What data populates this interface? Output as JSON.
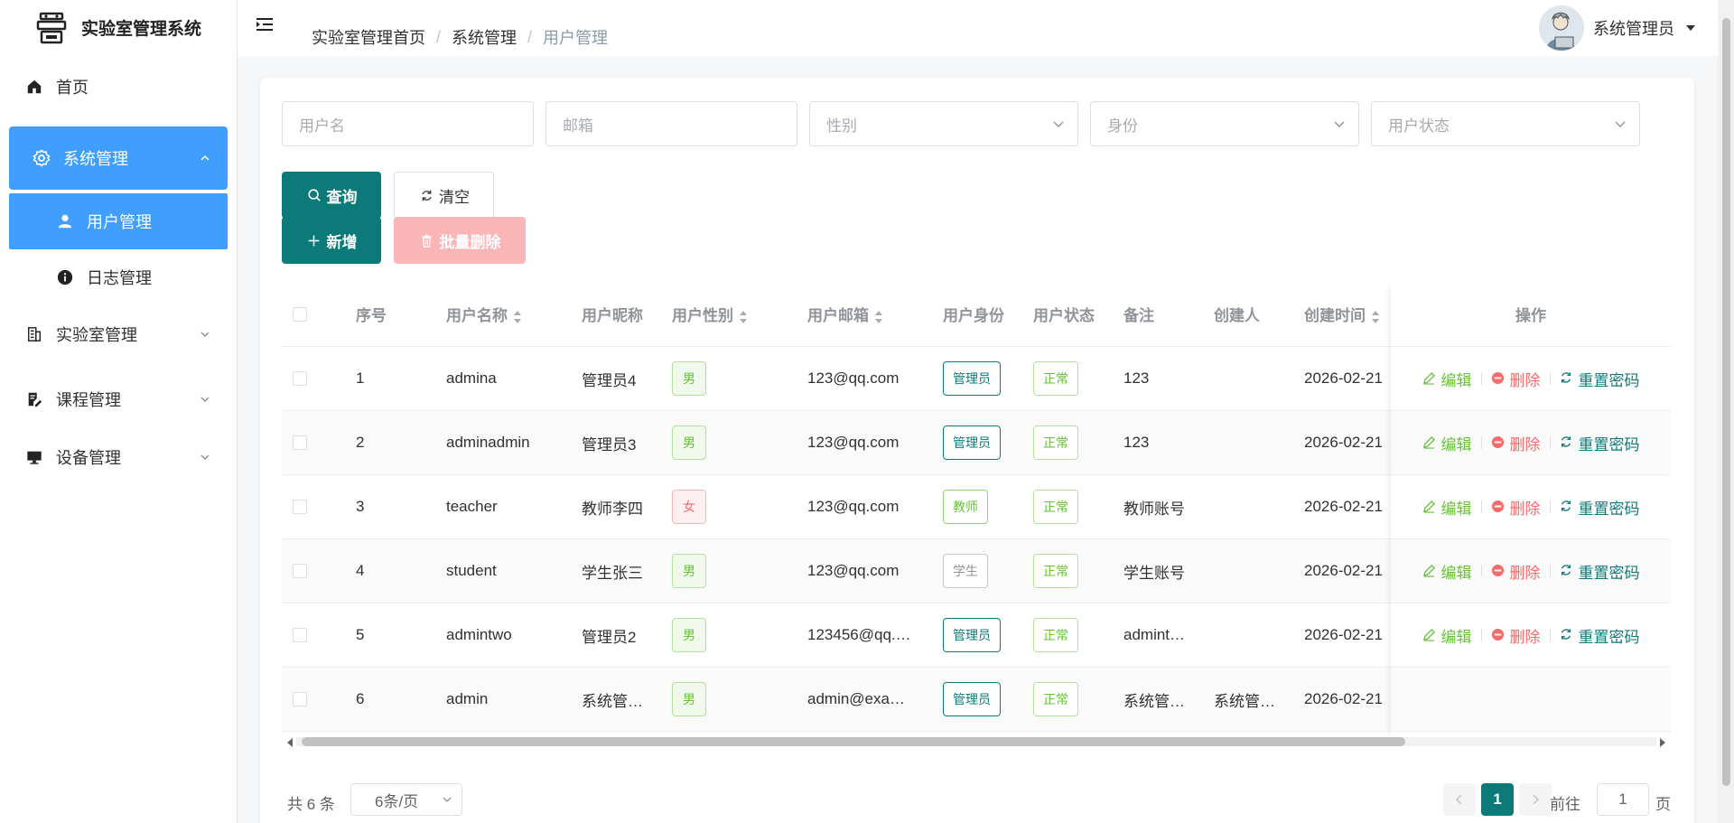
{
  "app": {
    "title": "实验室管理系统"
  },
  "sidebar": {
    "items": [
      {
        "label": "首页",
        "icon": "home-icon"
      },
      {
        "label": "系统管理",
        "icon": "gear-icon"
      },
      {
        "label": "用户管理",
        "icon": "user-icon"
      },
      {
        "label": "日志管理",
        "icon": "info-icon"
      },
      {
        "label": "实验室管理",
        "icon": "building-icon"
      },
      {
        "label": "课程管理",
        "icon": "document-edit-icon"
      },
      {
        "label": "设备管理",
        "icon": "monitor-icon"
      }
    ]
  },
  "header": {
    "breadcrumb": [
      "实验室管理首页",
      "系统管理",
      "用户管理"
    ],
    "separator": "/",
    "user_name": "系统管理员"
  },
  "filters": {
    "username_placeholder": "用户名",
    "email_placeholder": "邮箱",
    "gender_placeholder": "性别",
    "role_placeholder": "身份",
    "status_placeholder": "用户状态"
  },
  "toolbar": {
    "query_label": "查询",
    "clear_label": "清空",
    "add_label": "新增",
    "batch_delete_label": "批量删除"
  },
  "table": {
    "columns": [
      "序号",
      "用户名称",
      "用户昵称",
      "用户性别",
      "用户邮箱",
      "用户身份",
      "用户状态",
      "备注",
      "创建人",
      "创建时间",
      "操作"
    ],
    "rows": [
      {
        "index": "1",
        "username": "admina",
        "nickname": "管理员4",
        "gender": "男",
        "email": "123@qq.com",
        "role": "管理员",
        "status": "正常",
        "remark": "123",
        "creator": "",
        "created": "2026-02-21"
      },
      {
        "index": "2",
        "username": "adminadmin",
        "nickname": "管理员3",
        "gender": "男",
        "email": "123@qq.com",
        "role": "管理员",
        "status": "正常",
        "remark": "123",
        "creator": "",
        "created": "2026-02-21"
      },
      {
        "index": "3",
        "username": "teacher",
        "nickname": "教师李四",
        "gender": "女",
        "email": "123@qq.com",
        "role": "教师",
        "status": "正常",
        "remark": "教师账号",
        "creator": "",
        "created": "2026-02-21"
      },
      {
        "index": "4",
        "username": "student",
        "nickname": "学生张三",
        "gender": "男",
        "email": "123@qq.com",
        "role": "学生",
        "status": "正常",
        "remark": "学生账号",
        "creator": "",
        "created": "2026-02-21"
      },
      {
        "index": "5",
        "username": "admintwo",
        "nickname": "管理员2",
        "gender": "男",
        "email": "123456@qq.…",
        "role": "管理员",
        "status": "正常",
        "remark": "admint…",
        "creator": "",
        "created": "2026-02-21"
      },
      {
        "index": "6",
        "username": "admin",
        "nickname": "系统管…",
        "gender": "男",
        "email": "admin@exa…",
        "role": "管理员",
        "status": "正常",
        "remark": "系统管…",
        "creator": "系统管…",
        "created": "2026-02-21"
      }
    ],
    "ops": {
      "edit": "编辑",
      "delete": "删除",
      "reset": "重置密码"
    }
  },
  "pagination": {
    "total": "共 6 条",
    "page_size": "6条/页",
    "current_page": "1",
    "goto_prefix": "前往",
    "goto_value": "1",
    "goto_suffix": "页"
  },
  "colors": {
    "primary": "#0d7a7a",
    "menu_active": "#409eff",
    "danger": "#f56c6c",
    "success": "#67c23a"
  }
}
